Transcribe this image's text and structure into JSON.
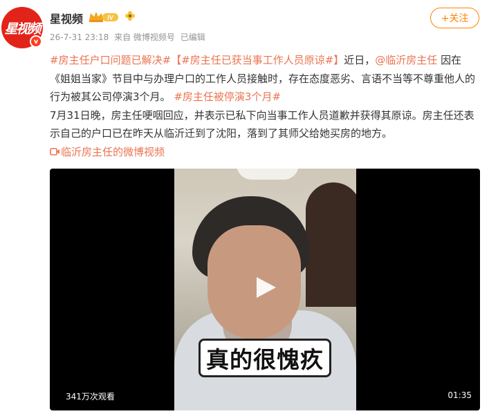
{
  "author": {
    "avatar_text": "星视频",
    "name": "星视频",
    "level_badge": "IV"
  },
  "meta": {
    "time": "26-7-31 23:18",
    "source": "来自 微博视频号",
    "edited": "已编辑"
  },
  "follow_button": {
    "label": "+关注"
  },
  "post": {
    "tag_resolved": "#房主任户口问题已解决#",
    "bracket_title": "【#房主任已获当事工作人员原谅#】",
    "recent": "近日，",
    "mention": "@临沂房主任",
    "body_1": " 因在《姐姐当家》节目中与办理户口的工作人员接触时，存在态度恶劣、言语不当等不尊重他人的行为被其公司停演3个月。",
    "tag_suspended": "#房主任被停演3个月#",
    "body_2": "7月31日晚，房主任哽咽回应，并表示已私下向当事工作人员道歉并获得其原谅。房主任还表示自己的户口已在昨天从临沂迁到了沈阳，落到了其师父给她买房的地方。",
    "video_link": "临沂房主任的微博视频"
  },
  "video": {
    "caption": "真的很愧疚",
    "views": "341万次观看",
    "duration": "01:35"
  },
  "colors": {
    "accent": "#eb7350",
    "follow": "#ff8200",
    "meta": "#939393",
    "brand_red": "#e2231a"
  },
  "icons": [
    "crown-icon",
    "flower-icon",
    "verified-icon",
    "video-link-icon",
    "play-icon"
  ]
}
